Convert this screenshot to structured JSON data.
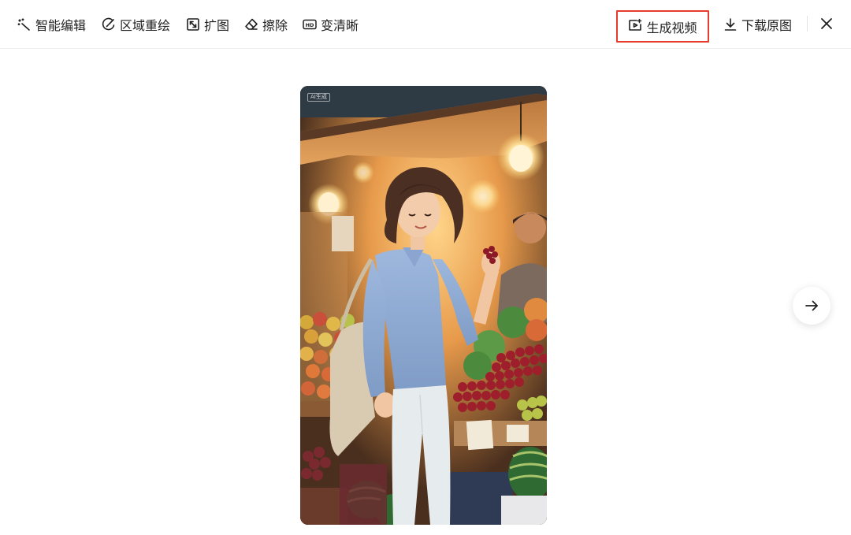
{
  "toolbar": {
    "smart_edit": {
      "label": "智能编辑",
      "icon": "magic-wand-icon"
    },
    "region_redraw": {
      "label": "区域重绘",
      "icon": "brush-icon"
    },
    "expand": {
      "label": "扩图",
      "icon": "expand-icon"
    },
    "erase": {
      "label": "擦除",
      "icon": "eraser-icon"
    },
    "enhance": {
      "label": "变清晰",
      "icon": "hd-icon"
    },
    "generate_video": {
      "label": "生成视频",
      "icon": "video-sparkle-icon",
      "highlight_color": "#e53c2d"
    },
    "download": {
      "label": "下载原图",
      "icon": "download-icon"
    },
    "close": {
      "icon": "close-icon"
    }
  },
  "image": {
    "badge": "AI生成"
  },
  "navigation": {
    "next": {
      "icon": "arrow-right-icon"
    }
  }
}
